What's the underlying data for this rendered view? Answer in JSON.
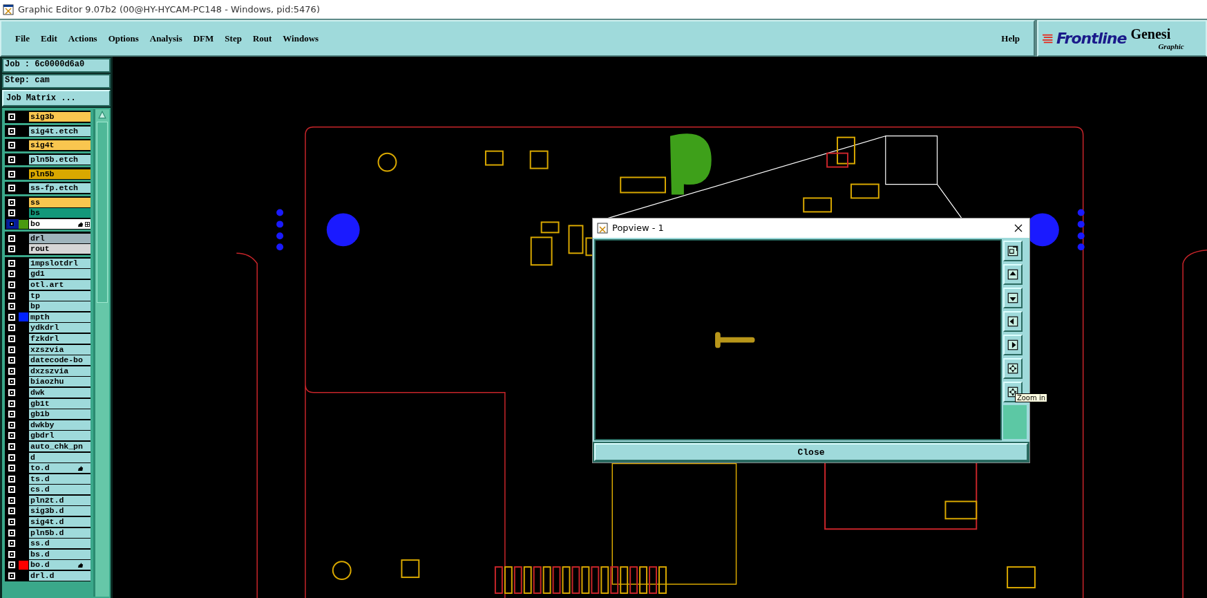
{
  "window": {
    "title": "Graphic Editor 9.07b2 (00@HY-HYCAM-PC148 - Windows, pid:5476)"
  },
  "menu": [
    "File",
    "Edit",
    "Actions",
    "Options",
    "Analysis",
    "DFM",
    "Step",
    "Rout",
    "Windows"
  ],
  "help": "Help",
  "logo": {
    "brand": "Frontline",
    "product": "Genesi",
    "subtitle": "Graphic"
  },
  "job": "Job : 6c0000d6a0",
  "step": "Step: cam",
  "job_matrix_button": "Job Matrix ...",
  "layer_groups": [
    {
      "layers": [
        {
          "name": "sig3b",
          "color": "#f9c64f",
          "selected": false,
          "hand": false
        }
      ]
    },
    {
      "layers": [
        {
          "name": "sig4t.etch",
          "color": "#9fdadb",
          "selected": false,
          "hand": false
        }
      ]
    },
    {
      "layers": [
        {
          "name": "sig4t",
          "color": "#f9c64f",
          "selected": false,
          "hand": false
        }
      ]
    },
    {
      "layers": [
        {
          "name": "pln5b.etch",
          "color": "#9fdadb",
          "selected": false,
          "hand": false
        }
      ]
    },
    {
      "layers": [
        {
          "name": "pln5b",
          "color": "#d9a800",
          "selected": false,
          "hand": false
        }
      ]
    },
    {
      "layers": [
        {
          "name": "ss-fp.etch",
          "color": "#9fdadb",
          "selected": false,
          "hand": false
        }
      ]
    },
    {
      "layers": [
        {
          "name": "ss",
          "color": "#f9c64f",
          "selected": false,
          "hand": false
        },
        {
          "name": "bs",
          "color": "#13987a",
          "selected": false,
          "hand": false
        },
        {
          "name": "bo",
          "color": "#ffffff",
          "swatch": {
            "color": "#4a9a10"
          },
          "selected": true,
          "hand": true
        }
      ]
    },
    {
      "layers": [
        {
          "name": "drl",
          "color": "#9fb4bc",
          "selected": false,
          "hand": false
        },
        {
          "name": "rout",
          "color": "#d6d6d6",
          "selected": false,
          "hand": false
        }
      ]
    },
    {
      "layers": [
        {
          "name": "1mpslotdrl",
          "color": "#9fdadb",
          "selected": false,
          "hand": false
        },
        {
          "name": "gd1",
          "color": "#9fdadb",
          "selected": false,
          "hand": false
        },
        {
          "name": "otl.art",
          "color": "#9fdadb",
          "selected": false,
          "hand": false
        },
        {
          "name": "tp",
          "color": "#9fdadb",
          "selected": false,
          "hand": false
        },
        {
          "name": "bp",
          "color": "#9fdadb",
          "selected": false,
          "hand": false
        },
        {
          "name": "mpth",
          "color": "#9fdadb",
          "swatch": {
            "color": "#0022ff"
          },
          "selected": false,
          "hand": false
        },
        {
          "name": "ydkdrl",
          "color": "#9fdadb",
          "selected": false,
          "hand": false
        },
        {
          "name": "fzkdrl",
          "color": "#9fdadb",
          "selected": false,
          "hand": false
        },
        {
          "name": "xzszvia",
          "color": "#9fdadb",
          "selected": false,
          "hand": false
        },
        {
          "name": "datecode-bo",
          "color": "#9fdadb",
          "selected": false,
          "hand": false
        },
        {
          "name": "dxzszvia",
          "color": "#9fdadb",
          "selected": false,
          "hand": false
        },
        {
          "name": "biaozhu",
          "color": "#9fdadb",
          "selected": false,
          "hand": false
        },
        {
          "name": "dwk",
          "color": "#9fdadb",
          "selected": false,
          "hand": false
        },
        {
          "name": "gb1t",
          "color": "#9fdadb",
          "selected": false,
          "hand": false
        },
        {
          "name": "gb1b",
          "color": "#9fdadb",
          "selected": false,
          "hand": false
        },
        {
          "name": "dwkby",
          "color": "#9fdadb",
          "selected": false,
          "hand": false
        },
        {
          "name": "gbdrl",
          "color": "#9fdadb",
          "selected": false,
          "hand": false
        },
        {
          "name": "auto_chk_pn",
          "color": "#9fdadb",
          "selected": false,
          "hand": false
        },
        {
          "name": "d",
          "color": "#9fdadb",
          "selected": false,
          "hand": false
        },
        {
          "name": "to.d",
          "color": "#9fdadb",
          "selected": false,
          "hand": true
        },
        {
          "name": "ts.d",
          "color": "#9fdadb",
          "selected": false,
          "hand": false
        },
        {
          "name": "cs.d",
          "color": "#9fdadb",
          "selected": false,
          "hand": false
        },
        {
          "name": "pln2t.d",
          "color": "#9fdadb",
          "selected": false,
          "hand": false
        },
        {
          "name": "sig3b.d",
          "color": "#9fdadb",
          "selected": false,
          "hand": false
        },
        {
          "name": "sig4t.d",
          "color": "#9fdadb",
          "selected": false,
          "hand": false
        },
        {
          "name": "pln5b.d",
          "color": "#9fdadb",
          "selected": false,
          "hand": false
        },
        {
          "name": "ss.d",
          "color": "#9fdadb",
          "selected": false,
          "hand": false
        },
        {
          "name": "bs.d",
          "color": "#9fdadb",
          "selected": false,
          "hand": false
        },
        {
          "name": "bo.d",
          "color": "#9fdadb",
          "swatch": {
            "color": "#ff0000"
          },
          "selected": false,
          "hand": true
        },
        {
          "name": "drl.d",
          "color": "#9fdadb",
          "selected": false,
          "hand": false
        }
      ]
    }
  ],
  "popview": {
    "title": "Popview - 1",
    "tooltip": "Zoom in",
    "close_button": "Close"
  }
}
